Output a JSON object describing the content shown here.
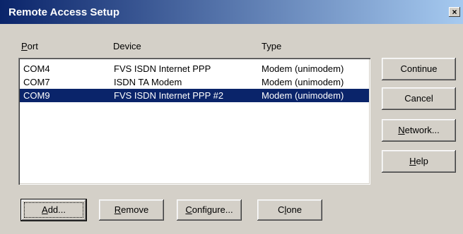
{
  "window": {
    "title": "Remote Access Setup",
    "close_glyph": "×"
  },
  "columns": [
    {
      "mnemonic": "P",
      "rest": "ort"
    },
    {
      "label": "Device"
    },
    {
      "label": "Type"
    }
  ],
  "rows": [
    {
      "port": "COM4",
      "device": "FVS ISDN Internet PPP",
      "type": "Modem (unimodem)",
      "selected": false
    },
    {
      "port": "COM7",
      "device": "ISDN TA Modem",
      "type": "Modem (unimodem)",
      "selected": false
    },
    {
      "port": "COM9",
      "device": "FVS ISDN Internet PPP #2",
      "type": "Modem (unimodem)",
      "selected": true
    }
  ],
  "side_buttons": {
    "continue": {
      "label": "Continue"
    },
    "cancel": {
      "label": "Cancel"
    },
    "network": {
      "mnemonic": "N",
      "rest": "etwork..."
    },
    "help": {
      "mnemonic": "H",
      "rest": "elp"
    }
  },
  "bottom_buttons": {
    "add": {
      "mnemonic": "A",
      "rest": "dd..."
    },
    "remove": {
      "mnemonic": "R",
      "rest": "emove"
    },
    "configure": {
      "mnemonic": "C",
      "rest": "onfigure..."
    },
    "clone": {
      "pre": "C",
      "mnemonic": "l",
      "rest": "one"
    }
  }
}
